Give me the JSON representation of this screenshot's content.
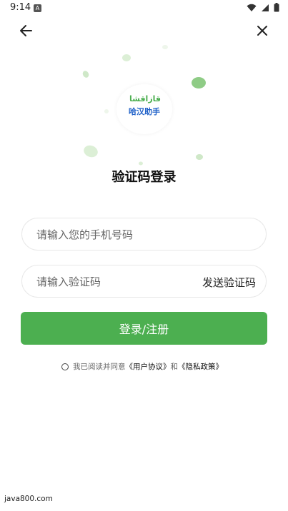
{
  "status_bar": {
    "time": "9:14",
    "notification_icon": "A"
  },
  "nav": {
    "back_icon": "arrow-left-icon",
    "close_icon": "close-icon"
  },
  "logo": {
    "uyghur_text": "قازاقشا",
    "chinese_text": "哈汉助手"
  },
  "title": "验证码登录",
  "phone": {
    "placeholder": "请输入您的手机号码",
    "value": ""
  },
  "code": {
    "placeholder": "请输入验证码",
    "value": "",
    "send_label": "发送验证码"
  },
  "login_button": "登录/注册",
  "agreement": {
    "prefix": "我已阅读并同意",
    "user_agreement": "《用户协议》",
    "and": "和",
    "privacy_policy": "《隐私政策》"
  },
  "watermark": "java800.com",
  "colors": {
    "accent": "#4caf50",
    "logo_blue": "#1e60c8",
    "bubble": "#dcefd6"
  }
}
